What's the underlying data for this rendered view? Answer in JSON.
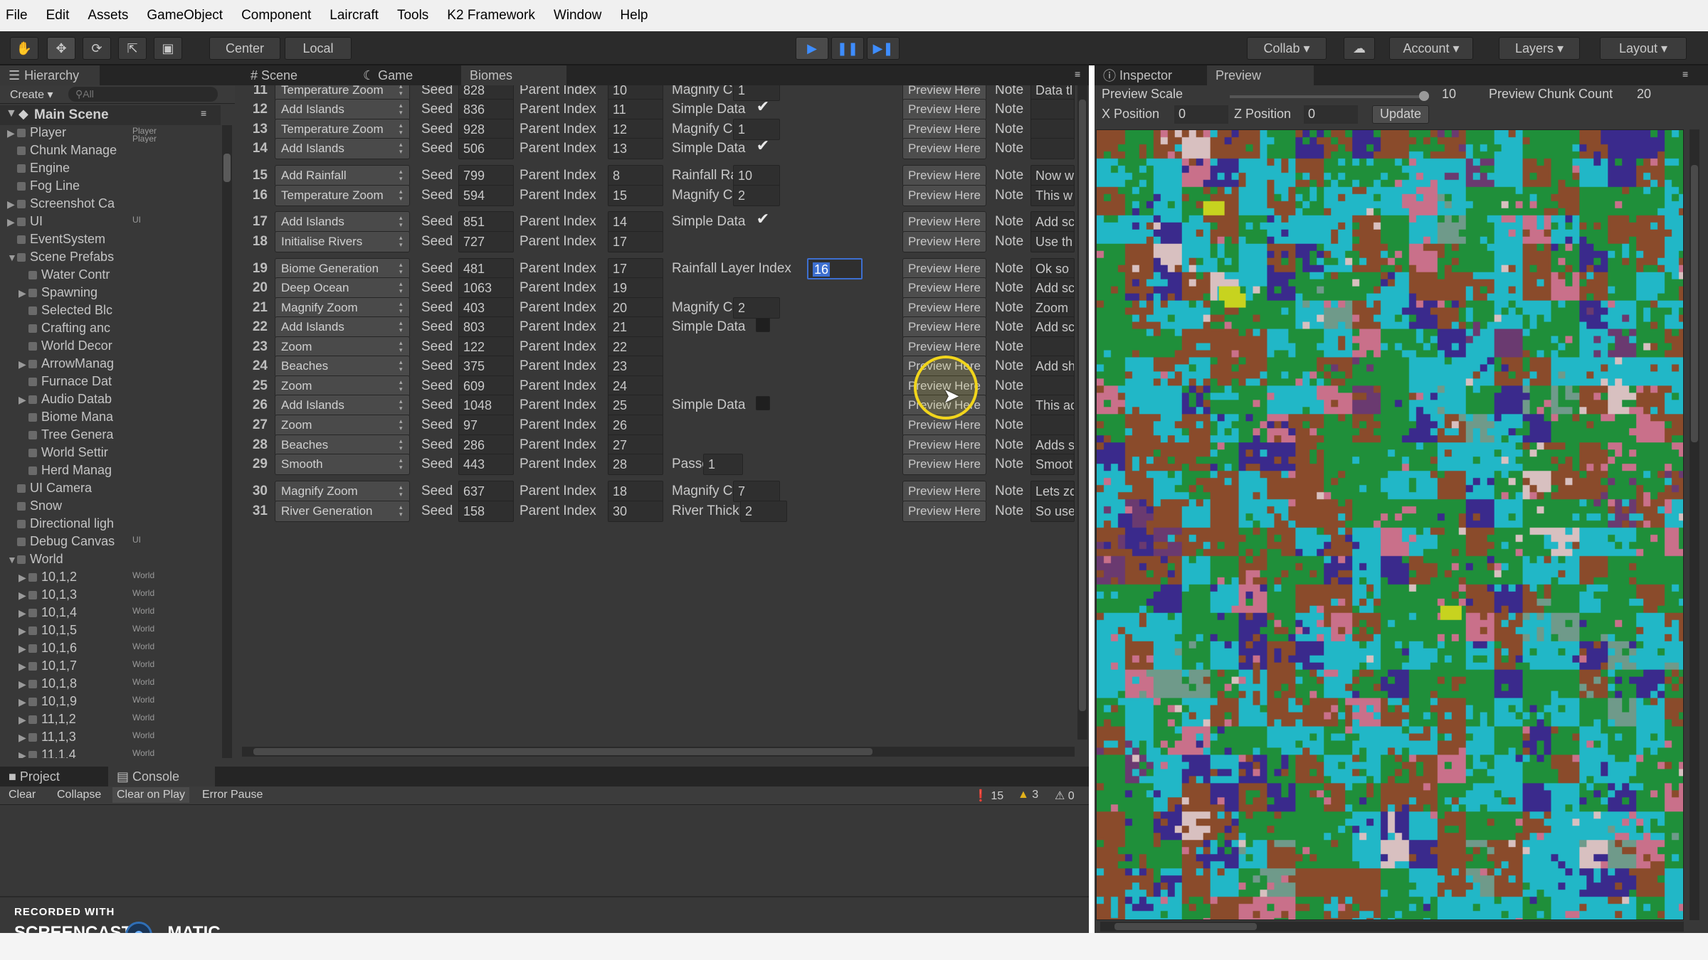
{
  "menu": [
    "File",
    "Edit",
    "Assets",
    "GameObject",
    "Component",
    "Laircraft",
    "Tools",
    "K2 Framework",
    "Window",
    "Help"
  ],
  "toolbar": {
    "center": "Center",
    "local": "Local",
    "collab": "Collab",
    "account": "Account",
    "layers": "Layers",
    "layout": "Layout"
  },
  "hierarchy": {
    "tab": "Hierarchy",
    "create": "Create",
    "search_placeholder": "All",
    "scene": "Main Scene",
    "items": [
      {
        "label": "Player",
        "tag": "Player\nPlayer",
        "indent": 1,
        "arrow": "▶"
      },
      {
        "label": "Chunk Manage",
        "tag": "",
        "indent": 1,
        "arrow": ""
      },
      {
        "label": "Engine",
        "tag": "",
        "indent": 1,
        "arrow": ""
      },
      {
        "label": "Fog Line",
        "tag": "",
        "indent": 1,
        "arrow": ""
      },
      {
        "label": "Screenshot Ca",
        "tag": "",
        "indent": 1,
        "arrow": "▶"
      },
      {
        "label": "UI",
        "tag": "UI",
        "indent": 1,
        "arrow": "▶"
      },
      {
        "label": "EventSystem",
        "tag": "",
        "indent": 1,
        "arrow": ""
      },
      {
        "label": "Scene Prefabs",
        "tag": "",
        "indent": 1,
        "arrow": "▼"
      },
      {
        "label": "Water Contr",
        "tag": "",
        "indent": 2,
        "arrow": ""
      },
      {
        "label": "Spawning",
        "tag": "",
        "indent": 2,
        "arrow": "▶"
      },
      {
        "label": "Selected Blc",
        "tag": "",
        "indent": 2,
        "arrow": ""
      },
      {
        "label": "Crafting anc",
        "tag": "",
        "indent": 2,
        "arrow": ""
      },
      {
        "label": "World Decor",
        "tag": "",
        "indent": 2,
        "arrow": ""
      },
      {
        "label": "ArrowManag",
        "tag": "",
        "indent": 2,
        "arrow": "▶"
      },
      {
        "label": "Furnace Dat",
        "tag": "",
        "indent": 2,
        "arrow": ""
      },
      {
        "label": "Audio Datab",
        "tag": "",
        "indent": 2,
        "arrow": "▶"
      },
      {
        "label": "Biome Mana",
        "tag": "",
        "indent": 2,
        "arrow": ""
      },
      {
        "label": "Tree Genera",
        "tag": "",
        "indent": 2,
        "arrow": ""
      },
      {
        "label": "World Settir",
        "tag": "",
        "indent": 2,
        "arrow": ""
      },
      {
        "label": "Herd Manag",
        "tag": "",
        "indent": 2,
        "arrow": ""
      },
      {
        "label": "UI Camera",
        "tag": "",
        "indent": 1,
        "arrow": ""
      },
      {
        "label": "Snow",
        "tag": "",
        "indent": 1,
        "arrow": ""
      },
      {
        "label": "Directional ligh",
        "tag": "",
        "indent": 1,
        "arrow": ""
      },
      {
        "label": "Debug Canvas",
        "tag": "UI",
        "indent": 1,
        "arrow": ""
      },
      {
        "label": "World",
        "tag": "",
        "indent": 1,
        "arrow": "▼"
      },
      {
        "label": "10,1,2",
        "tag": "World",
        "indent": 2,
        "arrow": "▶"
      },
      {
        "label": "10,1,3",
        "tag": "World",
        "indent": 2,
        "arrow": "▶"
      },
      {
        "label": "10,1,4",
        "tag": "World",
        "indent": 2,
        "arrow": "▶"
      },
      {
        "label": "10,1,5",
        "tag": "World",
        "indent": 2,
        "arrow": "▶"
      },
      {
        "label": "10,1,6",
        "tag": "World",
        "indent": 2,
        "arrow": "▶"
      },
      {
        "label": "10,1,7",
        "tag": "World",
        "indent": 2,
        "arrow": "▶"
      },
      {
        "label": "10,1,8",
        "tag": "World",
        "indent": 2,
        "arrow": "▶"
      },
      {
        "label": "10,1,9",
        "tag": "World",
        "indent": 2,
        "arrow": "▶"
      },
      {
        "label": "11,1,2",
        "tag": "World",
        "indent": 2,
        "arrow": "▶"
      },
      {
        "label": "11,1,3",
        "tag": "World",
        "indent": 2,
        "arrow": "▶"
      },
      {
        "label": "11,1,4",
        "tag": "World",
        "indent": 2,
        "arrow": "▶"
      }
    ]
  },
  "editor_tabs": {
    "scene": "Scene",
    "game": "Game",
    "biomes": "Biomes"
  },
  "labels": {
    "seed": "Seed",
    "parent": "Parent Index",
    "note": "Note",
    "preview": "Preview Here"
  },
  "rows": [
    {
      "n": "11",
      "layer": "Temperature Zoom",
      "seed": "828",
      "parent": "10",
      "extra": "Magnify Count",
      "extraVal": "1",
      "note": "Data tl",
      "kind": "field"
    },
    {
      "n": "12",
      "layer": "Add Islands",
      "seed": "836",
      "parent": "11",
      "extra": "Simple Data",
      "extraVal": "✔",
      "note": "",
      "kind": "check"
    },
    {
      "n": "13",
      "layer": "Temperature Zoom",
      "seed": "928",
      "parent": "12",
      "extra": "Magnify Count",
      "extraVal": "1",
      "note": "",
      "kind": "field"
    },
    {
      "n": "14",
      "layer": "Add Islands",
      "seed": "506",
      "parent": "13",
      "extra": "Simple Data",
      "extraVal": "✔",
      "note": "",
      "kind": "check"
    },
    {
      "n": "15",
      "layer": "Add Rainfall",
      "seed": "799",
      "parent": "8",
      "extra": "Rainfall Range",
      "extraVal": "10",
      "note": "Now w",
      "kind": "field"
    },
    {
      "n": "16",
      "layer": "Temperature Zoom",
      "seed": "594",
      "parent": "15",
      "extra": "Magnify Count",
      "extraVal": "2",
      "note": "This w",
      "kind": "field"
    },
    {
      "n": "17",
      "layer": "Add Islands",
      "seed": "851",
      "parent": "14",
      "extra": "Simple Data",
      "extraVal": "✔",
      "note": "Add sc",
      "kind": "check"
    },
    {
      "n": "18",
      "layer": "Initialise Rivers",
      "seed": "727",
      "parent": "17",
      "extra": "",
      "extraVal": "",
      "note": "Use th",
      "kind": "none"
    },
    {
      "n": "19",
      "layer": "Biome Generation",
      "seed": "481",
      "parent": "17",
      "extra": "Rainfall Layer Index",
      "extraVal": "16",
      "note": "Ok so",
      "kind": "selected"
    },
    {
      "n": "20",
      "layer": "Deep Ocean",
      "seed": "1063",
      "parent": "19",
      "extra": "",
      "extraVal": "",
      "note": "Add sc",
      "kind": "none"
    },
    {
      "n": "21",
      "layer": "Magnify Zoom",
      "seed": "403",
      "parent": "20",
      "extra": "Magnify Count",
      "extraVal": "2",
      "note": "Zoom",
      "kind": "field"
    },
    {
      "n": "22",
      "layer": "Add Islands",
      "seed": "803",
      "parent": "21",
      "extra": "Simple Data",
      "extraVal": "",
      "note": "Add sc",
      "kind": "check"
    },
    {
      "n": "23",
      "layer": "Zoom",
      "seed": "122",
      "parent": "22",
      "extra": "",
      "extraVal": "",
      "note": "",
      "kind": "none"
    },
    {
      "n": "24",
      "layer": "Beaches",
      "seed": "375",
      "parent": "23",
      "extra": "",
      "extraVal": "",
      "note": "Add sh",
      "kind": "none"
    },
    {
      "n": "25",
      "layer": "Zoom",
      "seed": "609",
      "parent": "24",
      "extra": "",
      "extraVal": "",
      "note": "",
      "kind": "none"
    },
    {
      "n": "26",
      "layer": "Add Islands",
      "seed": "1048",
      "parent": "25",
      "extra": "Simple Data",
      "extraVal": "",
      "note": "This ac",
      "kind": "check"
    },
    {
      "n": "27",
      "layer": "Zoom",
      "seed": "97",
      "parent": "26",
      "extra": "",
      "extraVal": "",
      "note": "",
      "kind": "none"
    },
    {
      "n": "28",
      "layer": "Beaches",
      "seed": "286",
      "parent": "27",
      "extra": "",
      "extraVal": "",
      "note": "Adds s",
      "kind": "none"
    },
    {
      "n": "29",
      "layer": "Smooth",
      "seed": "443",
      "parent": "28",
      "extra": "Passes",
      "extraVal": "1",
      "note": "Smoot",
      "kind": "field"
    },
    {
      "n": "30",
      "layer": "Magnify Zoom",
      "seed": "637",
      "parent": "18",
      "extra": "Magnify Count",
      "extraVal": "7",
      "note": "Lets zc",
      "kind": "field"
    },
    {
      "n": "31",
      "layer": "River Generation",
      "seed": "158",
      "parent": "30",
      "extra": "River Thickness",
      "extraVal": "2",
      "note": "So use",
      "kind": "field"
    }
  ],
  "console": {
    "tab_project": "Project",
    "tab_console": "Console",
    "clear": "Clear",
    "collapse": "Collapse",
    "clear_on_play": "Clear on Play",
    "error_pause": "Error Pause",
    "log_count": "15",
    "warn_count": "3",
    "error_count": "0"
  },
  "inspector": {
    "tab_inspector": "Inspector",
    "tab_preview": "Preview",
    "preview_scale_label": "Preview Scale",
    "preview_scale_value": "10",
    "preview_scale_level": 1.0,
    "chunk_count_label": "Preview Chunk Count",
    "chunk_count_value": "20",
    "x_label": "X Position",
    "x_value": "0",
    "z_label": "Z Position",
    "z_value": "0",
    "update": "Update"
  },
  "watermark": {
    "line1": "RECORDED WITH",
    "left": "SCREENCAST",
    "right": "MATIC"
  },
  "colors": {
    "biome_palette": [
      "#1f8f3a",
      "#21b7c7",
      "#8a4b2b",
      "#3a2a8c",
      "#c9708a",
      "#c7d31f",
      "#6f9a8a",
      "#d8c0c0",
      "#6a3a70"
    ]
  }
}
